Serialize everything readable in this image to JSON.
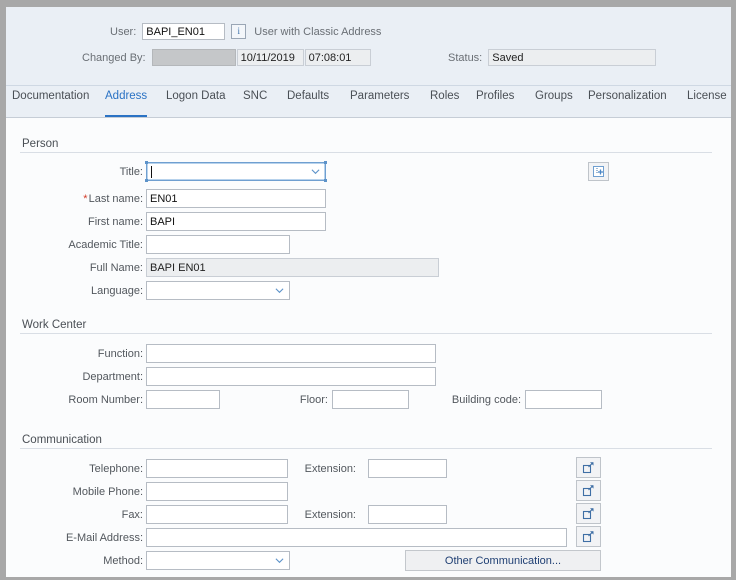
{
  "header": {
    "user_label": "User:",
    "user_value": "BAPI_EN01",
    "info_icon": "info-icon",
    "info_glyph": "i",
    "user_type_text": "User with Classic Address",
    "changed_by_label": "Changed By:",
    "changed_by_value": "",
    "changed_date": "10/11/2019",
    "changed_time": "07:08:01",
    "status_label": "Status:",
    "status_value": "Saved"
  },
  "tabs": [
    {
      "label": "Documentation",
      "active": false
    },
    {
      "label": "Address",
      "active": true
    },
    {
      "label": "Logon Data",
      "active": false
    },
    {
      "label": "SNC",
      "active": false
    },
    {
      "label": "Defaults",
      "active": false
    },
    {
      "label": "Parameters",
      "active": false
    },
    {
      "label": "Roles",
      "active": false
    },
    {
      "label": "Profiles",
      "active": false
    },
    {
      "label": "Groups",
      "active": false
    },
    {
      "label": "Personalization",
      "active": false
    },
    {
      "label": "License",
      "active": false
    }
  ],
  "person": {
    "group_label": "Person",
    "title_label": "Title:",
    "title_value": "",
    "last_name_label": "Last name:",
    "last_name_value": "EN01",
    "last_name_required": "*",
    "first_name_label": "First name:",
    "first_name_value": "BAPI",
    "academic_title_label": "Academic Title:",
    "academic_title_value": "",
    "full_name_label": "Full Name:",
    "full_name_value": "BAPI EN01",
    "language_label": "Language:",
    "language_value": "",
    "person_action_icon": "add-person-card-icon"
  },
  "work_center": {
    "group_label": "Work Center",
    "function_label": "Function:",
    "function_value": "",
    "department_label": "Department:",
    "department_value": "",
    "room_number_label": "Room Number:",
    "room_number_value": "",
    "floor_label": "Floor:",
    "floor_value": "",
    "building_code_label": "Building code:",
    "building_code_value": ""
  },
  "communication": {
    "group_label": "Communication",
    "telephone_label": "Telephone:",
    "telephone_value": "",
    "telephone_ext_label": "Extension:",
    "telephone_ext_value": "",
    "mobile_label": "Mobile Phone:",
    "mobile_value": "",
    "fax_label": "Fax:",
    "fax_value": "",
    "fax_ext_label": "Extension:",
    "fax_ext_value": "",
    "email_label": "E-Mail Address:",
    "email_value": "",
    "method_label": "Method:",
    "method_value": "",
    "other_communication_label": "Other Communication...",
    "expand_icon": "open-details-icon"
  },
  "colors": {
    "accent": "#2a72c4",
    "required": "#d23b28",
    "header_bg": "#eaeff5",
    "content_bg": "#fbfcfd",
    "button_text": "#1f3f73"
  }
}
